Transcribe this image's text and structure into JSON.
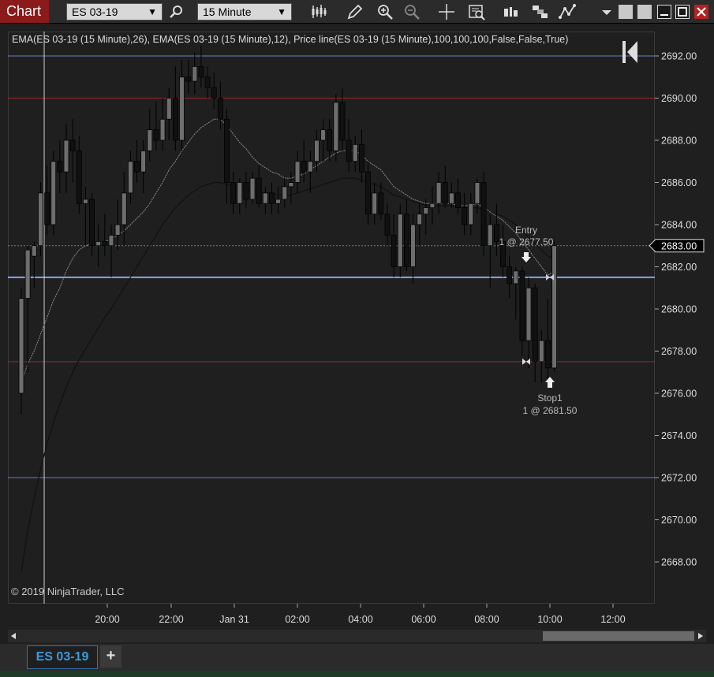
{
  "toolbar": {
    "title": "Chart",
    "instrument": "ES 03-19",
    "interval": "15 Minute",
    "icons": [
      "bar-type-icon",
      "pencil-icon",
      "zoom-in-icon",
      "zoom-out-icon",
      "crosshair-icon",
      "data-box-icon",
      "strategies-icon",
      "indicators-icon",
      "drawing-tools-icon",
      "menu-dropdown-icon",
      "minimize-icon",
      "maximize-icon",
      "close-icon"
    ]
  },
  "indicator_label": "EMA(ES 03-19 (15 Minute),26), EMA(ES 03-19 (15 Minute),12), Price line(ES 03-19 (15 Minute),100,100,100,False,False,True)",
  "copyright": "© 2019 NinjaTrader, LLC",
  "bottom_tabs": {
    "active": "ES 03-19",
    "add": "+"
  },
  "colors": {
    "hline_blue": "#6a7fc0",
    "hline_red": "#9e2828",
    "price_line": "#3a8fc8",
    "entry_line": "#86a8e8",
    "chart_tab": "#8b1a1a"
  },
  "chart_data": {
    "type": "candlestick",
    "ylim": [
      2666.5,
      2693.2
    ],
    "y_ticks": [
      "2692.00",
      "2690.00",
      "2688.00",
      "2686.00",
      "2684.00",
      "2682.00",
      "2680.00",
      "2678.00",
      "2676.00",
      "2674.00",
      "2672.00",
      "2670.00",
      "2668.00"
    ],
    "x_ticks": [
      "20:00",
      "22:00",
      "Jan 31",
      "02:00",
      "04:00",
      "06:00",
      "08:00",
      "10:00",
      "12:00"
    ],
    "current_price": "2683.00",
    "horizontal_lines": [
      {
        "price": 2692.0,
        "color": "blue"
      },
      {
        "price": 2690.0,
        "color": "red"
      },
      {
        "price": 2681.5,
        "color": "entry"
      },
      {
        "price": 2677.5,
        "color": "red"
      },
      {
        "price": 2672.0,
        "color": "blue"
      }
    ],
    "annotations": [
      {
        "name": "Entry",
        "detail": "1 @ 2677.50",
        "price": 2677.5
      },
      {
        "name": "Stop1",
        "detail": "1 @ 2681.50",
        "price": 2681.5
      }
    ],
    "candles": [
      [
        2676,
        2681,
        2675,
        2680.5
      ],
      [
        2680.5,
        2683,
        2677,
        2682.8
      ],
      [
        2682.5,
        2683.2,
        2681,
        2683
      ],
      [
        2683,
        2686,
        2682.5,
        2685.5
      ],
      [
        2685.5,
        2686.8,
        2683.5,
        2684
      ],
      [
        2684,
        2687.5,
        2683.5,
        2687
      ],
      [
        2687,
        2688,
        2685.5,
        2686.5
      ],
      [
        2686.5,
        2688.8,
        2685.5,
        2688
      ],
      [
        2688,
        2689,
        2686,
        2687.5
      ],
      [
        2687.5,
        2688.2,
        2684.5,
        2685
      ],
      [
        2685,
        2685.8,
        2683,
        2685.2
      ],
      [
        2685.2,
        2685.5,
        2682.5,
        2683
      ],
      [
        2683,
        2684,
        2682,
        2683.2
      ],
      [
        2683.2,
        2684.5,
        2682.5,
        2683
      ],
      [
        2683,
        2684,
        2681.5,
        2683.5
      ],
      [
        2683.5,
        2685.2,
        2682.8,
        2684
      ],
      [
        2684,
        2686.5,
        2683,
        2685.5
      ],
      [
        2685.5,
        2687.5,
        2685,
        2687
      ],
      [
        2687,
        2688,
        2686,
        2686.5
      ],
      [
        2686.5,
        2688,
        2685.5,
        2687.5
      ],
      [
        2687.5,
        2689.5,
        2687,
        2688.5
      ],
      [
        2688.5,
        2689.8,
        2687.5,
        2688
      ],
      [
        2688,
        2690,
        2687.5,
        2689
      ],
      [
        2689,
        2690.5,
        2688,
        2690
      ],
      [
        2690,
        2691.5,
        2687.5,
        2688
      ],
      [
        2688,
        2691.8,
        2687.5,
        2691
      ],
      [
        2691,
        2691.8,
        2690.2,
        2690.8
      ],
      [
        2690.8,
        2692.2,
        2690.2,
        2691.5
      ],
      [
        2691.5,
        2692.5,
        2690.5,
        2691
      ],
      [
        2691,
        2691.5,
        2690,
        2690.5
      ],
      [
        2690.5,
        2691.2,
        2689.5,
        2690
      ],
      [
        2690,
        2690.8,
        2688.5,
        2689
      ],
      [
        2689,
        2689.5,
        2685,
        2686
      ],
      [
        2686,
        2686.5,
        2684.5,
        2685
      ],
      [
        2685,
        2686.2,
        2684.5,
        2686
      ],
      [
        2686,
        2686.5,
        2684.8,
        2685.2
      ],
      [
        2685.2,
        2686.5,
        2685,
        2686.2
      ],
      [
        2686.2,
        2686.8,
        2684.8,
        2685
      ],
      [
        2685,
        2685.8,
        2684.5,
        2685.5
      ],
      [
        2685.5,
        2686,
        2684.5,
        2685
      ],
      [
        2685,
        2685.8,
        2684.5,
        2685.2
      ],
      [
        2685.2,
        2686.2,
        2684.8,
        2685.8
      ],
      [
        2685.8,
        2686.5,
        2685,
        2686
      ],
      [
        2686,
        2687.5,
        2685.5,
        2687
      ],
      [
        2687,
        2688,
        2686,
        2686.5
      ],
      [
        2686.5,
        2687.5,
        2685.5,
        2687
      ],
      [
        2687,
        2688.5,
        2686.5,
        2688
      ],
      [
        2688,
        2689,
        2687,
        2688.5
      ],
      [
        2688.5,
        2689,
        2687,
        2687.5
      ],
      [
        2687.5,
        2690.2,
        2687,
        2689.8
      ],
      [
        2689.8,
        2690.5,
        2687.5,
        2688
      ],
      [
        2688,
        2689,
        2686.5,
        2687
      ],
      [
        2687,
        2688.2,
        2686.5,
        2687.8
      ],
      [
        2687.8,
        2688.5,
        2686,
        2686.5
      ],
      [
        2686.5,
        2687,
        2684,
        2684.5
      ],
      [
        2684.5,
        2686,
        2684,
        2685.5
      ],
      [
        2685.5,
        2686,
        2684.2,
        2684.5
      ],
      [
        2684.5,
        2685,
        2683,
        2683.5
      ],
      [
        2683.5,
        2684.5,
        2681.5,
        2682
      ],
      [
        2682,
        2685,
        2681.5,
        2684.5
      ],
      [
        2684.5,
        2685.2,
        2681.8,
        2682
      ],
      [
        2682,
        2684.5,
        2681.2,
        2684
      ],
      [
        2684,
        2685,
        2683,
        2684.5
      ],
      [
        2684.5,
        2685.2,
        2683.5,
        2684.8
      ],
      [
        2684.8,
        2685.8,
        2684,
        2685
      ],
      [
        2685,
        2686.5,
        2684.5,
        2686
      ],
      [
        2686,
        2686.8,
        2684.8,
        2685
      ],
      [
        2685,
        2686,
        2684.8,
        2685.5
      ],
      [
        2685.5,
        2686.2,
        2684.5,
        2684.8
      ],
      [
        2684.8,
        2685.5,
        2683.5,
        2684
      ],
      [
        2684,
        2685.5,
        2683.5,
        2685
      ],
      [
        2685,
        2686.2,
        2684.5,
        2686
      ],
      [
        2686,
        2686.5,
        2682.5,
        2683
      ],
      [
        2683,
        2684.5,
        2681,
        2684
      ],
      [
        2684,
        2685,
        2682.5,
        2683.2
      ],
      [
        2683.2,
        2684,
        2681.5,
        2682
      ],
      [
        2682,
        2682.5,
        2680.5,
        2681.2
      ],
      [
        2681.2,
        2682,
        2679.5,
        2681.8
      ],
      [
        2681.8,
        2682,
        2677.8,
        2678.5
      ],
      [
        2678.5,
        2681.5,
        2677.2,
        2681
      ],
      [
        2681,
        2681.2,
        2676.5,
        2677.5
      ],
      [
        2677.5,
        2679,
        2676.5,
        2678.5
      ],
      [
        2678.5,
        2680.5,
        2676.5,
        2677.2
      ],
      [
        2677.2,
        2683.2,
        2677,
        2683
      ]
    ],
    "ema_12": [
      2676.5,
      2677.4,
      2678,
      2678.8,
      2679.6,
      2680.4,
      2681,
      2681.8,
      2682.4,
      2682.8,
      2683,
      2683.1,
      2683.1,
      2683.2,
      2683.3,
      2683.5,
      2683.7,
      2684,
      2684.3,
      2684.6,
      2685,
      2685.5,
      2686,
      2686.6,
      2687,
      2687.5,
      2687.9,
      2688.3,
      2688.6,
      2688.8,
      2689,
      2689,
      2688.7,
      2688.3,
      2687.9,
      2687.6,
      2687.2,
      2686.9,
      2686.7,
      2686.5,
      2686.4,
      2686.2,
      2686.2,
      2686.3,
      2686.4,
      2686.6,
      2686.8,
      2687,
      2687.2,
      2687.4,
      2687.5,
      2687.5,
      2687.5,
      2687.3,
      2687,
      2686.8,
      2686.6,
      2686.2,
      2685.8,
      2685.6,
      2685.4,
      2685.2,
      2685.1,
      2685,
      2685,
      2685,
      2685,
      2685,
      2684.9,
      2684.9,
      2684.9,
      2685,
      2684.8,
      2684.6,
      2684.4,
      2684.2,
      2683.9,
      2683.6,
      2683.2,
      2682.8,
      2682.4,
      2682,
      2681.6,
      2681.8
    ],
    "ema_26": [
      2667.5,
      2669.5,
      2671,
      2672.4,
      2673.6,
      2674.6,
      2675.5,
      2676.3,
      2677,
      2677.6,
      2678.1,
      2678.6,
      2679.1,
      2679.6,
      2680,
      2680.5,
      2681,
      2681.5,
      2682,
      2682.5,
      2683,
      2683.5,
      2684,
      2684.4,
      2684.8,
      2685.1,
      2685.4,
      2685.6,
      2685.8,
      2685.9,
      2686,
      2686,
      2685.9,
      2685.8,
      2685.7,
      2685.6,
      2685.6,
      2685.5,
      2685.5,
      2685.5,
      2685.4,
      2685.4,
      2685.4,
      2685.5,
      2685.6,
      2685.7,
      2685.8,
      2685.9,
      2686,
      2686.1,
      2686.2,
      2686.2,
      2686.2,
      2686.1,
      2686,
      2685.9,
      2685.8,
      2685.6,
      2685.4,
      2685.3,
      2685.2,
      2685.1,
      2685,
      2684.9,
      2684.9,
      2684.9,
      2684.9,
      2684.9,
      2684.9,
      2684.8,
      2684.8,
      2684.8,
      2684.7,
      2684.6,
      2684.5,
      2684.4,
      2684.2,
      2684,
      2683.7,
      2683.4,
      2683.1,
      2682.8,
      2682.5,
      2682.4
    ]
  }
}
